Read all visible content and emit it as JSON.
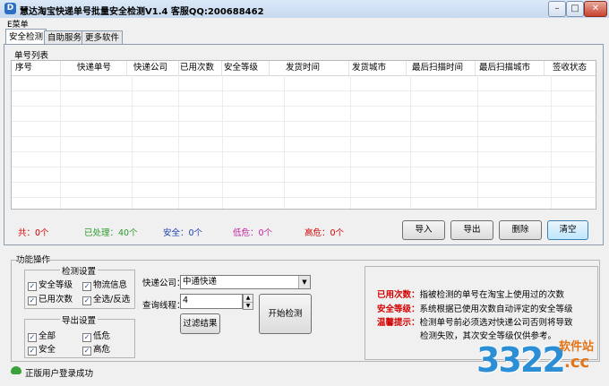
{
  "window": {
    "title": "慧达淘宝快递单号批量安全检测V1.4 客服QQ:200688462"
  },
  "menu": {
    "label": "E菜单"
  },
  "tabs": [
    {
      "label": "安全检测",
      "active": true
    },
    {
      "label": "自助服务",
      "active": false
    },
    {
      "label": "更多软件",
      "active": false
    }
  ],
  "list": {
    "title": "单号列表",
    "columns": [
      "序号",
      "快递单号",
      "快递公司",
      "已用次数",
      "安全等级",
      "发货时间",
      "发货城市",
      "最后扫描时间",
      "最后扫描城市",
      "签收状态"
    ],
    "rows": []
  },
  "stats": {
    "total": "共：0个",
    "processed": "已处理：40个",
    "safe": "安全：0个",
    "low": "低危：0个",
    "high": "高危：0个",
    "colors": {
      "total": "#d40000",
      "processed": "#2a9a2a",
      "safe": "#1a3fb0",
      "low": "#c020a0",
      "high": "#d40000"
    }
  },
  "actions": {
    "import": "导入",
    "export": "导出",
    "delete": "删除",
    "clear": "清空"
  },
  "func": {
    "title": "功能操作",
    "detect": {
      "title": "检测设置",
      "items": [
        {
          "label": "安全等级",
          "checked": true
        },
        {
          "label": "物流信息",
          "checked": true
        },
        {
          "label": "已用次数",
          "checked": true
        },
        {
          "label": "全选/反选",
          "checked": true
        }
      ]
    },
    "export": {
      "title": "导出设置",
      "items": [
        {
          "label": "全部",
          "checked": true
        },
        {
          "label": "低危",
          "checked": true
        },
        {
          "label": "安全",
          "checked": true
        },
        {
          "label": "高危",
          "checked": true
        }
      ]
    },
    "company_label": "快递公司：",
    "company_value": "中通快递",
    "threads_label": "查询线程：",
    "threads_value": "4",
    "filter_button": "过滤结果",
    "start_button": "开始检测"
  },
  "info": {
    "used_key": "已用次数：",
    "used_text": "指被检测的单号在淘宝上使用过的次数",
    "safe_key": "安全等级：",
    "safe_text": "系统根据已使用次数自动评定的安全等级",
    "tip_key": "温馨提示：",
    "tip_text": "检测单号前必须选对快递公司否则将导致",
    "tip_text2": "检测失败，其次安全等级仅供参考。"
  },
  "status": {
    "text": "正版用户登录成功"
  },
  "watermark": {
    "big": "3322",
    "small_cn": "软件站",
    "small_en": ".cc"
  }
}
